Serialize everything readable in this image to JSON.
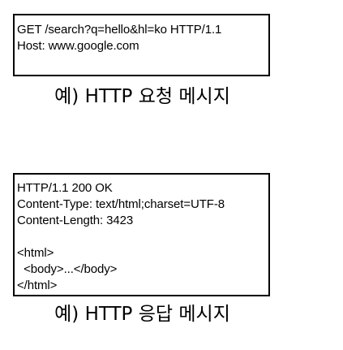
{
  "request": {
    "lines": [
      "GET /search?q=hello&hl=ko HTTP/1.1",
      "Host: www.google.com"
    ],
    "caption": "예) HTTP 요청 메시지"
  },
  "response": {
    "lines": [
      "HTTP/1.1 200 OK",
      "Content-Type: text/html;charset=UTF-8",
      "Content-Length: 3423",
      "",
      "<html>",
      "  <body>...</body>",
      "</html>"
    ],
    "caption": "예) HTTP 응답 메시지"
  }
}
